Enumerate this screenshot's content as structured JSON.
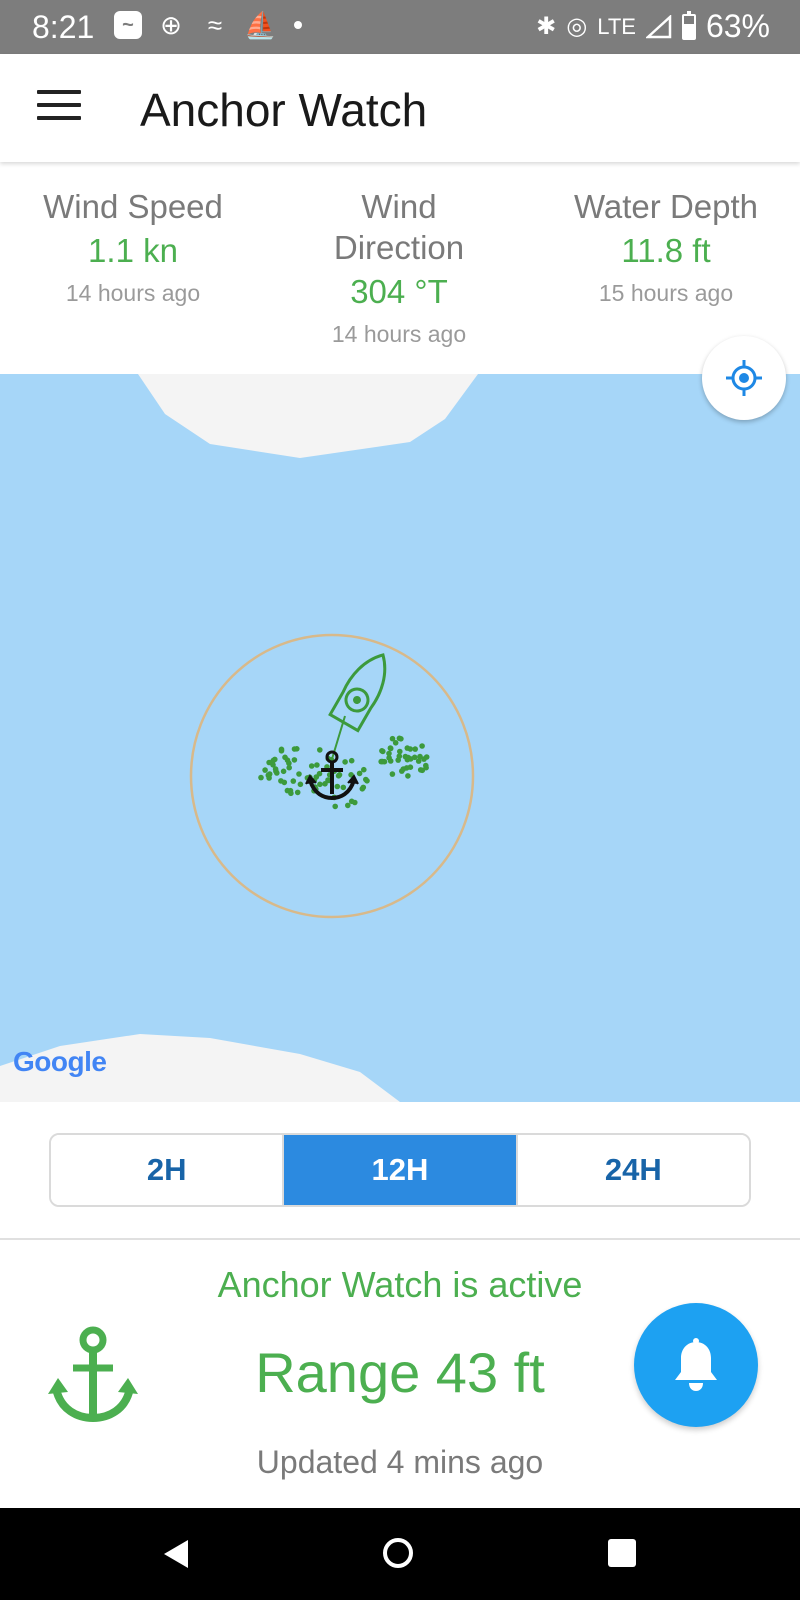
{
  "statusbar": {
    "time": "8:21",
    "network": "LTE",
    "battery": "63%",
    "icons": [
      "messenger-icon",
      "plus-circle-icon",
      "antenna-icon",
      "marine-icon",
      "bluetooth-icon",
      "hotspot-icon",
      "signal-icon",
      "battery-icon"
    ]
  },
  "appbar": {
    "title": "Anchor Watch"
  },
  "stats": [
    {
      "label": "Wind Speed",
      "value": "1.1 kn",
      "age": "14 hours ago"
    },
    {
      "label": "Wind Direction",
      "value": "304 °T",
      "age": "14 hours ago"
    },
    {
      "label": "Water Depth",
      "value": "11.8 ft",
      "age": "15 hours ago"
    }
  ],
  "map": {
    "attribution": "Google",
    "water_color": "#a6d6f8",
    "land_color": "#f4f4f4",
    "circle_color": "#d8b98a",
    "track_color": "#3c9a3c"
  },
  "segments": {
    "options": [
      "2H",
      "12H",
      "24H"
    ],
    "selected": "12H"
  },
  "watch": {
    "status": "Anchor Watch is active",
    "range": "Range 43 ft",
    "updated": "Updated 4 mins ago",
    "accent": "#4caf50",
    "bell_color": "#1da1f2"
  }
}
